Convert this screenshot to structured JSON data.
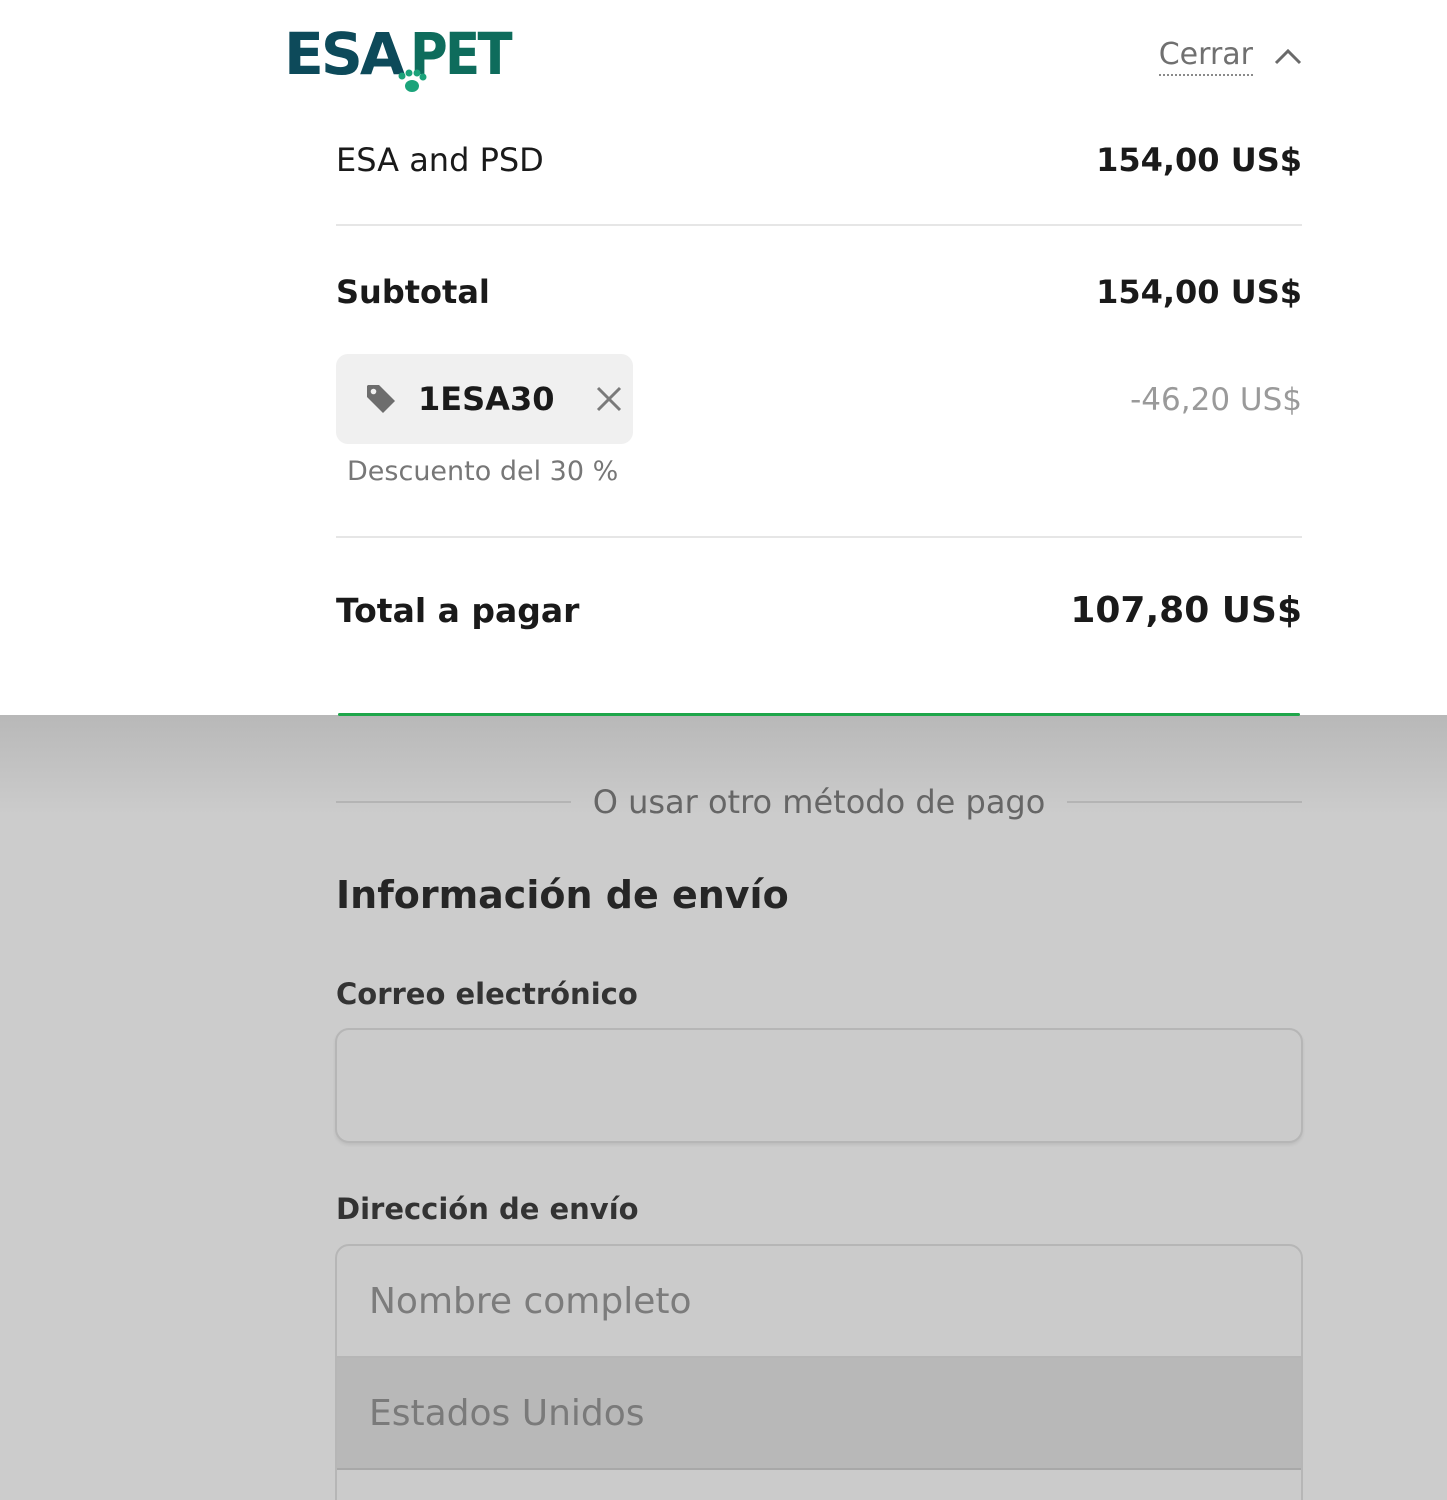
{
  "header": {
    "logo_text": "ESAPET",
    "close_label": "Cerrar"
  },
  "summary": {
    "item": {
      "name": "ESA and PSD",
      "price": "154,00 US$"
    },
    "subtotal": {
      "label": "Subtotal",
      "value": "154,00 US$"
    },
    "promo": {
      "code": "1ESA30",
      "description": "Descuento del 30 %",
      "amount": "-46,20 US$"
    },
    "total": {
      "label": "Total a pagar",
      "value": "107,80 US$"
    }
  },
  "form": {
    "divider_text": "O usar otro método de pago",
    "section_title": "Información de envío",
    "email_label": "Correo electrónico",
    "email_value": "",
    "address_label": "Dirección de envío",
    "name_placeholder": "Nombre completo",
    "country_value": "Estados Unidos"
  },
  "colors": {
    "brand_dark": "#0d4a5a",
    "brand_green": "#1ea64a",
    "overlay_shade": "#cccccc"
  },
  "icons": {
    "close_toggle": "chevron-up-icon",
    "promo_tag": "tag-icon",
    "promo_remove": "close-icon"
  }
}
